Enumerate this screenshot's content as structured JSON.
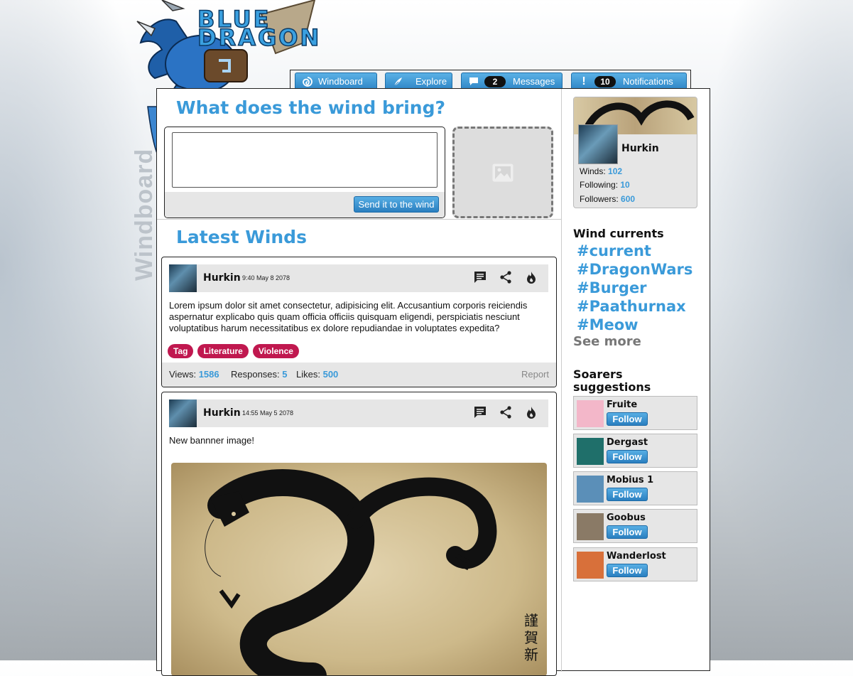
{
  "app": {
    "logo_text_line1": "BLUE",
    "logo_text_line2": "DRAGON",
    "side_title": "Windboard"
  },
  "nav": {
    "tabs": [
      {
        "label": "Windboard",
        "icon": "swirl-icon"
      },
      {
        "label": "Explore",
        "icon": "feather-icon"
      },
      {
        "label": "Messages",
        "icon": "chat-icon",
        "count": "2"
      },
      {
        "label": "Notifications",
        "icon": "exclamation-icon",
        "count": "10"
      }
    ]
  },
  "compose": {
    "heading": "What does the wind bring?",
    "textarea_value": "",
    "send_label": "Send it to the wind",
    "image_placeholder_icon": "image-icon"
  },
  "feed": {
    "heading": "Latest Winds",
    "posts": [
      {
        "user": "Hurkin",
        "time": "9:40 May 8 2078",
        "text": "Lorem ipsum dolor sit amet consectetur, adipisicing elit. Accusantium corporis reiciendis aspernatur explicabo quis quam officia officiis quisquam eligendi, perspiciatis nesciunt voluptatibus harum necessitatibus ex dolore repudiandae in voluptates expedita?",
        "tags": [
          "Tag",
          "Literature",
          "Violence"
        ],
        "views_label": "Views:",
        "views": "1586",
        "responses_label": "Responses:",
        "responses": "5",
        "likes_label": "Likes:",
        "likes": "500",
        "report": "Report"
      },
      {
        "user": "Hurkin",
        "time": "14:55 May 5 2078",
        "text": "New bannner image!",
        "image_calligraphy": "謹賀新"
      }
    ]
  },
  "profile": {
    "name": "Hurkin",
    "winds_label": "Winds:",
    "winds": "102",
    "following_label": "Following:",
    "following": "10",
    "followers_label": "Followers:",
    "followers": "600"
  },
  "currents": {
    "title": "Wind currents",
    "tags": [
      "#current",
      "#DragonWars",
      "#Burger",
      "#Paathurnax",
      "#Meow"
    ],
    "see_more": "See more"
  },
  "suggestions": {
    "title_line1": "Soarers",
    "title_line2": "suggestions",
    "follow_label": "Follow",
    "users": [
      {
        "name": "Fruite",
        "color": "#f3b7c9"
      },
      {
        "name": "Dergast",
        "color": "#1f6f6a"
      },
      {
        "name": "Mobius 1",
        "color": "#5b8fb8"
      },
      {
        "name": "Goobus",
        "color": "#8a7a66"
      },
      {
        "name": "Wanderlost",
        "color": "#d8703a"
      }
    ]
  },
  "colors": {
    "accent": "#3a9ad9",
    "tag": "#c0184f"
  }
}
